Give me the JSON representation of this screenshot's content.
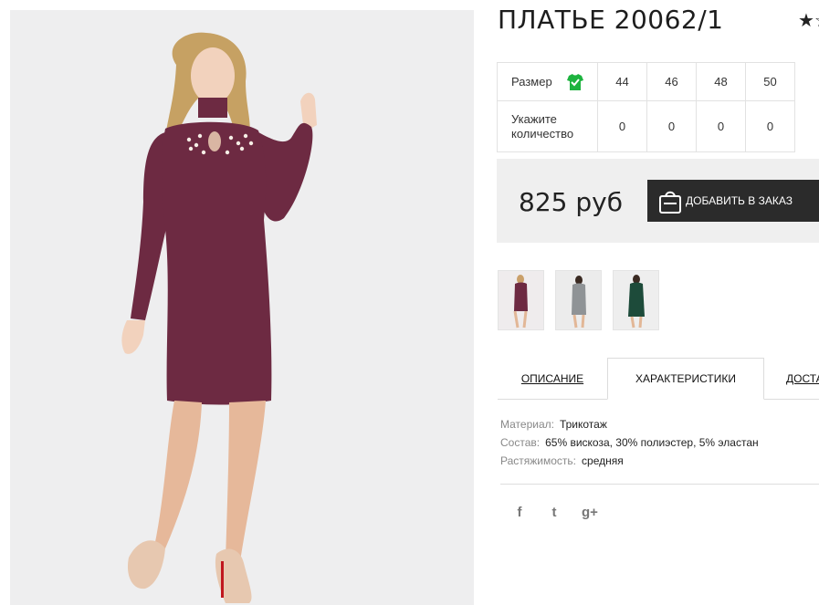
{
  "product": {
    "title": "ПЛАТЬЕ 20062/1",
    "rating_icon": "star-icon",
    "rating_glyph": "★☆"
  },
  "size_table": {
    "size_label": "Размер",
    "size_icon": "green-shirt-check-icon",
    "quantity_label": "Укажите количество",
    "sizes": [
      "44",
      "46",
      "48",
      "50"
    ],
    "quantities": [
      "0",
      "0",
      "0",
      "0"
    ]
  },
  "purchase": {
    "price": "825 руб",
    "add_to_cart_label": "ДОБАВИТЬ В ЗАКАЗ",
    "button_icon": "shopping-bag-icon"
  },
  "colors": {
    "accent_green": "#1db33f",
    "dress_burgundy": "#6d2a42",
    "dress_grey": "#8f9396",
    "dress_green": "#1d4b3a",
    "button_dark": "#2b2b2b"
  },
  "thumbnails": [
    {
      "color_name": "burgundy"
    },
    {
      "color_name": "grey"
    },
    {
      "color_name": "green"
    }
  ],
  "tabs": [
    {
      "label": "ОПИСАНИЕ",
      "active": false
    },
    {
      "label": "ХАРАКТЕРИСТИКИ",
      "active": true
    },
    {
      "label": "ДОСТАВКА",
      "active": false
    }
  ],
  "specs": [
    {
      "label": "Материал:",
      "value": "Трикотаж"
    },
    {
      "label": "Состав:",
      "value": "65% вискоза, 30% полиэстер, 5% эластан"
    },
    {
      "label": "Растяжимость:",
      "value": "средняя"
    }
  ],
  "social": [
    {
      "name": "facebook-icon",
      "glyph": "f"
    },
    {
      "name": "twitter-icon",
      "glyph": "t"
    },
    {
      "name": "google-plus-icon",
      "glyph": "g+"
    }
  ]
}
